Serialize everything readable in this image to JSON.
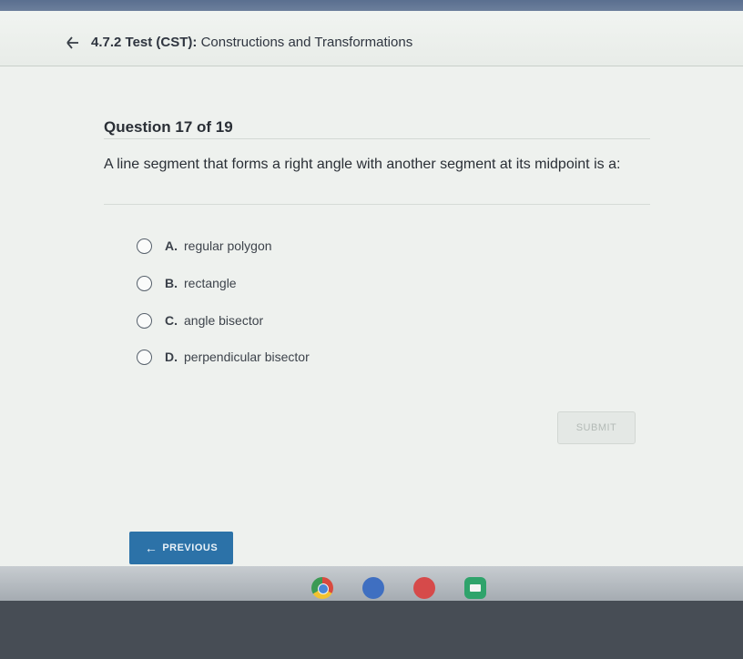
{
  "header": {
    "course_code": "4.7.2 Test (CST):",
    "course_name": "Constructions and Transformations"
  },
  "question": {
    "counter": "Question 17 of 19",
    "prompt": "A line segment that forms a right angle with another segment at its midpoint is a:",
    "options": [
      {
        "letter": "A.",
        "text": "regular polygon"
      },
      {
        "letter": "B.",
        "text": "rectangle"
      },
      {
        "letter": "C.",
        "text": "angle bisector"
      },
      {
        "letter": "D.",
        "text": "perpendicular bisector"
      }
    ]
  },
  "buttons": {
    "submit_label": "SUBMIT",
    "previous_label": "PREVIOUS"
  },
  "shelf": {
    "apps": [
      "chrome-icon",
      "app-icon",
      "app-icon",
      "meet-icon"
    ]
  },
  "colors": {
    "accent": "#2c72a8",
    "background": "#eef1ee"
  }
}
